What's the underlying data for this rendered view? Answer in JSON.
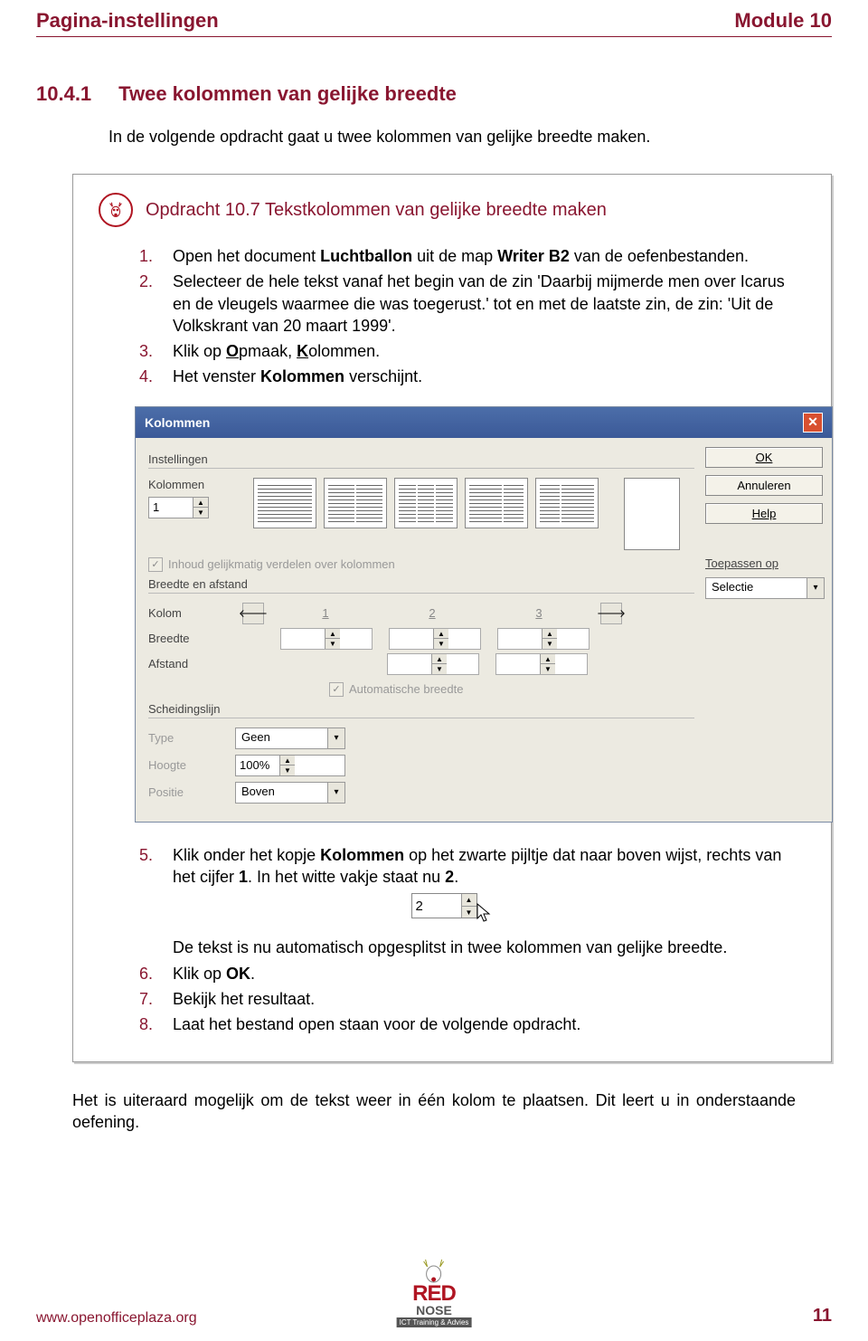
{
  "header": {
    "left": "Pagina-instellingen",
    "right": "Module 10"
  },
  "section": {
    "num": "10.4.1",
    "title": "Twee kolommen van gelijke breedte"
  },
  "intro": "In de volgende opdracht gaat u twee kolommen van gelijke breedte maken.",
  "opdracht": {
    "title": "Opdracht 10.7 Tekstkolommen van gelijke breedte maken",
    "steps1": [
      {
        "n": "1.",
        "parts": [
          "Open het document ",
          "Luchtballon",
          " uit de map ",
          "Writer B2",
          " van de oefenbestanden."
        ],
        "bolds": [
          1,
          3
        ]
      },
      {
        "n": "2.",
        "parts": [
          "Selecteer de hele tekst vanaf het begin van de zin 'Daarbij mijmerde men over Icarus en de vleugels waarmee die was toegerust.' tot en met de laatste zin, de zin: 'Uit de Volkskrant van 20 maart 1999'."
        ],
        "bolds": []
      },
      {
        "n": "3.",
        "parts": [
          "Klik op ",
          "O",
          "pmaak, ",
          "K",
          "olommen."
        ],
        "bolds": [
          1,
          3
        ],
        "uls": [
          1,
          3
        ]
      },
      {
        "n": "4.",
        "parts": [
          "Het venster ",
          "Kolommen",
          " verschijnt."
        ],
        "bolds": [
          1
        ]
      }
    ],
    "steps2": [
      {
        "n": "5.",
        "parts": [
          "Klik onder het kopje ",
          "Kolommen",
          " op het zwarte pijltje dat naar boven wijst, rechts van het cijfer ",
          "1",
          ". In het witte vakje staat nu ",
          "2",
          "."
        ],
        "bolds": [
          1,
          3,
          5
        ]
      },
      {
        "n": "",
        "parts": [
          "De tekst is nu automatisch opgesplitst in twee kolommen van gelijke breedte."
        ],
        "bolds": []
      },
      {
        "n": "6.",
        "parts": [
          "Klik op ",
          "OK",
          "."
        ],
        "bolds": [
          1
        ]
      },
      {
        "n": "7.",
        "parts": [
          "Bekijk het resultaat."
        ],
        "bolds": []
      },
      {
        "n": "8.",
        "parts": [
          "Laat het bestand open staan voor de volgende opdracht."
        ],
        "bolds": []
      }
    ],
    "spin_value": "2"
  },
  "dialog": {
    "title": "Kolommen",
    "buttons": {
      "ok": "OK",
      "cancel": "Annuleren",
      "help": "Help"
    },
    "apply_label": "Toepassen op",
    "apply_value": "Selectie",
    "group_settings": "Instellingen",
    "label_columns": "Kolommen",
    "columns_value": "1",
    "chk_label": "Inhoud gelijkmatig verdelen over kolommen",
    "group_width": "Breedte en afstand",
    "row_kolom": "Kolom",
    "row_breedte": "Breedte",
    "row_afstand": "Afstand",
    "col_nums": [
      "1",
      "2",
      "3"
    ],
    "chk_auto": "Automatische breedte",
    "group_line": "Scheidingslijn",
    "row_type": "Type",
    "type_value": "Geen",
    "row_height": "Hoogte",
    "height_value": "100%",
    "row_pos": "Positie",
    "pos_value": "Boven"
  },
  "closing": "Het is uiteraard mogelijk om de tekst weer in één kolom te plaatsen. Dit leert u in onderstaande oefening.",
  "footer": {
    "url": "www.openofficeplaza.org",
    "page": "11",
    "logo_main": "RED",
    "logo_sub": "NOSE",
    "logo_tag": "ICT Training & Advies"
  }
}
